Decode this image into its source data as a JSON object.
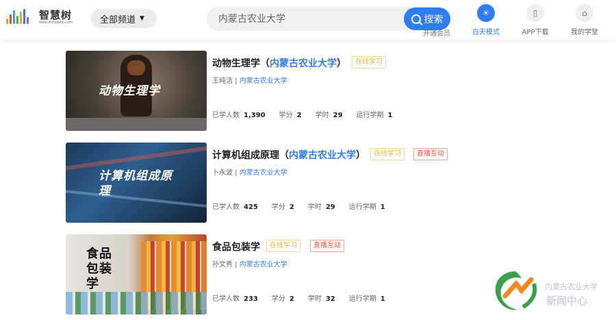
{
  "header": {
    "logo_text": "智慧树",
    "logo_url": "www.zhihuishu.com",
    "channel_label": "全部频道",
    "search_placeholder": "内蒙古农业大学",
    "search_button": "搜索",
    "partial_link": "开通会员",
    "nav": [
      {
        "label": "白天模式",
        "icon": "sun-icon",
        "active": true
      },
      {
        "label": "APP下载",
        "icon": "phone-icon",
        "active": false
      },
      {
        "label": "我的学堂",
        "icon": "home-icon",
        "active": false
      }
    ]
  },
  "courses": [
    {
      "name": "动物生理学",
      "university": "内蒙古农业大学",
      "tags": [
        "在线学习"
      ],
      "teacher": "王纯洁",
      "school": "内蒙古农业大学",
      "thumb_title": "动物生理学",
      "stats": {
        "learners_label": "已学人数",
        "learners": "1,390",
        "credits_label": "学分",
        "credits": "2",
        "hours_label": "学时",
        "hours": "29",
        "term_label": "运行学期",
        "term": "1"
      }
    },
    {
      "name": "计算机组成原理",
      "university": "内蒙古农业大学",
      "tags": [
        "在线学习",
        "直播互动"
      ],
      "teacher": "卜永波",
      "school": "内蒙古农业大学",
      "thumb_title": "计算机组成原理",
      "stats": {
        "learners_label": "已学人数",
        "learners": "425",
        "credits_label": "学分",
        "credits": "2",
        "hours_label": "学时",
        "hours": "29",
        "term_label": "运行学期",
        "term": "1"
      }
    },
    {
      "name": "食品包装学",
      "university": "",
      "tags": [
        "在线学习",
        "直播互动"
      ],
      "teacher": "孙文秀",
      "school": "内蒙古农业大学",
      "thumb_title": "食品包装学",
      "stats": {
        "learners_label": "已学人数",
        "learners": "233",
        "credits_label": "学分",
        "credits": "2",
        "hours_label": "学时",
        "hours": "32",
        "term_label": "运行学期",
        "term": "1"
      }
    }
  ],
  "watermark": {
    "line1": "内蒙古农业大学",
    "line2": "新闻中心"
  },
  "colors": {
    "accent": "#2f7df6",
    "tag_online": "#f0b23c",
    "tag_live": "#e85a37"
  }
}
